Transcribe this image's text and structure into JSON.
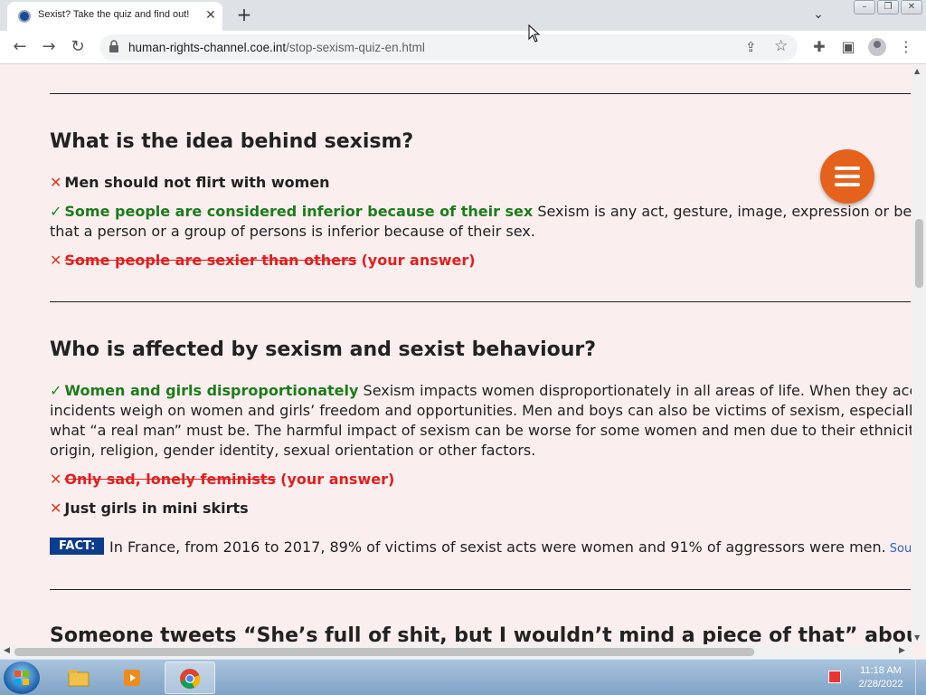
{
  "browser": {
    "tab_title": "Sexist? Take the quiz and find out!",
    "tab_close": "✕",
    "new_tab": "+",
    "url_host": "human-rights-channel.coe.int",
    "url_path": "/stop-sexism-quiz-en.html"
  },
  "questions": [
    {
      "title": "What is the idea behind sexism?",
      "answers": [
        {
          "mark": "✕",
          "correct": false,
          "text": "Men should not flirt with women"
        },
        {
          "mark": "✓",
          "correct": true,
          "text": "Some people are considered inferior because of their sex",
          "explanation_line1": "Sexism is any act, gesture, image, expression or behaviour based",
          "explanation_line2": "that a person or a group of persons is inferior because of their sex."
        },
        {
          "mark": "✕",
          "correct": false,
          "text": "Some people are sexier than others",
          "note": "(your answer)"
        }
      ]
    },
    {
      "title": "Who is affected by sexism and sexist behaviour?",
      "answers": [
        {
          "mark": "✓",
          "correct": true,
          "text": "Women and girls disproportionately",
          "explanation_line1": "Sexism impacts women disproportionately in all areas of life. When they accumulate c",
          "explanation_line2": "incidents weigh on women and girls’ freedom and opportunities. Men and boys can also be victims of sexism, especially whe",
          "explanation_line3": "what “a real man” must be. The harmful impact of sexism can be worse for some women and men due to their ethnicity, age,",
          "explanation_line4": "origin, religion, gender identity, sexual orientation or other factors."
        },
        {
          "mark": "✕",
          "correct": false,
          "text": "Only sad, lonely feminists",
          "note": "(your answer)"
        },
        {
          "mark": "✕",
          "correct": false,
          "text": "Just girls in mini skirts"
        }
      ],
      "fact_label": "FACT:",
      "fact_text": "In France, from 2016 to 2017, 89% of victims of sexist acts were women and 91% of aggressors were men.",
      "fact_source": "Source"
    },
    {
      "title": "Someone tweets “She’s full of shit, but I wouldn’t mind a piece of that” about a woman"
    }
  ],
  "taskbar": {
    "time": "11:18 AM",
    "date": "2/28/2022"
  },
  "colors": {
    "page_bg": "#fbeeee",
    "correct": "#1b7c1b",
    "wrong": "#e02020",
    "fact_badge": "#0c3c8c",
    "menu_button": "#e5621d"
  }
}
